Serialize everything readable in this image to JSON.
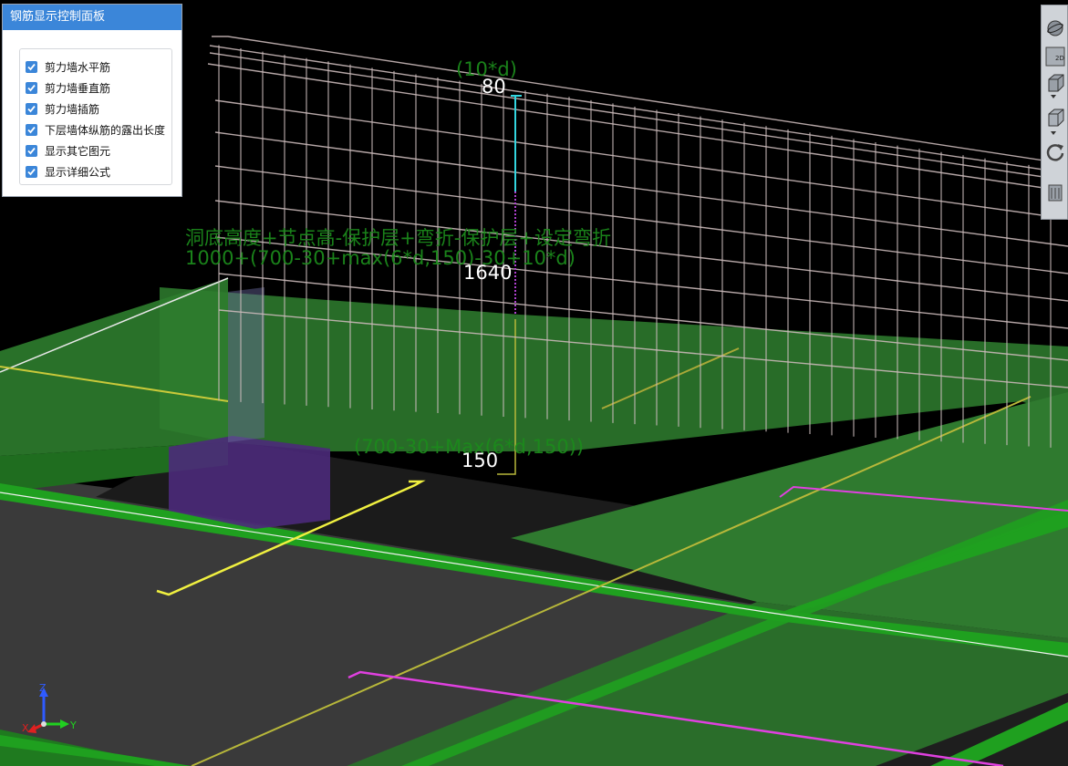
{
  "panel": {
    "title": "钢筋显示控制面板",
    "options": [
      {
        "label": "剪力墙水平筋",
        "checked": true
      },
      {
        "label": "剪力墙垂直筋",
        "checked": true
      },
      {
        "label": "剪力墙插筋",
        "checked": true
      },
      {
        "label": "下层墙体纵筋的露出长度",
        "checked": true
      },
      {
        "label": "显示其它图元",
        "checked": true
      },
      {
        "label": "显示详细公式",
        "checked": true
      }
    ]
  },
  "toolbar": {
    "items": [
      {
        "icon": "sphere-view-icon"
      },
      {
        "icon": "2d-view-icon",
        "text": "2D"
      },
      {
        "icon": "cube-view-icon"
      },
      {
        "icon": "cube-outline-icon"
      },
      {
        "icon": "rotate-icon"
      },
      {
        "icon": "layers-icon"
      }
    ]
  },
  "annotations": {
    "top_formula": "(10*d)",
    "top_value": "80",
    "formula_line1": "洞底高度+节点高-保护层+弯折-保护层+设定弯折",
    "formula_line2": "1000+(700-30+max(6*d,150)-30+10*d)",
    "mid_value": "1640",
    "bottom_formula": "(700-30+Max(6*d,150))",
    "bottom_value": "150"
  },
  "axis": {
    "z": "Z",
    "x": "X",
    "y": "Y"
  },
  "colors": {
    "accent": "#3b86d9",
    "formula_green": "#1c8a1c",
    "slab_green": "#1f8f1f",
    "wall_green": "#3f9b3f",
    "rebar_yellow": "#e6e63a",
    "rebar_magenta": "#e040e0",
    "opening_purple": "#4b2a7a"
  }
}
